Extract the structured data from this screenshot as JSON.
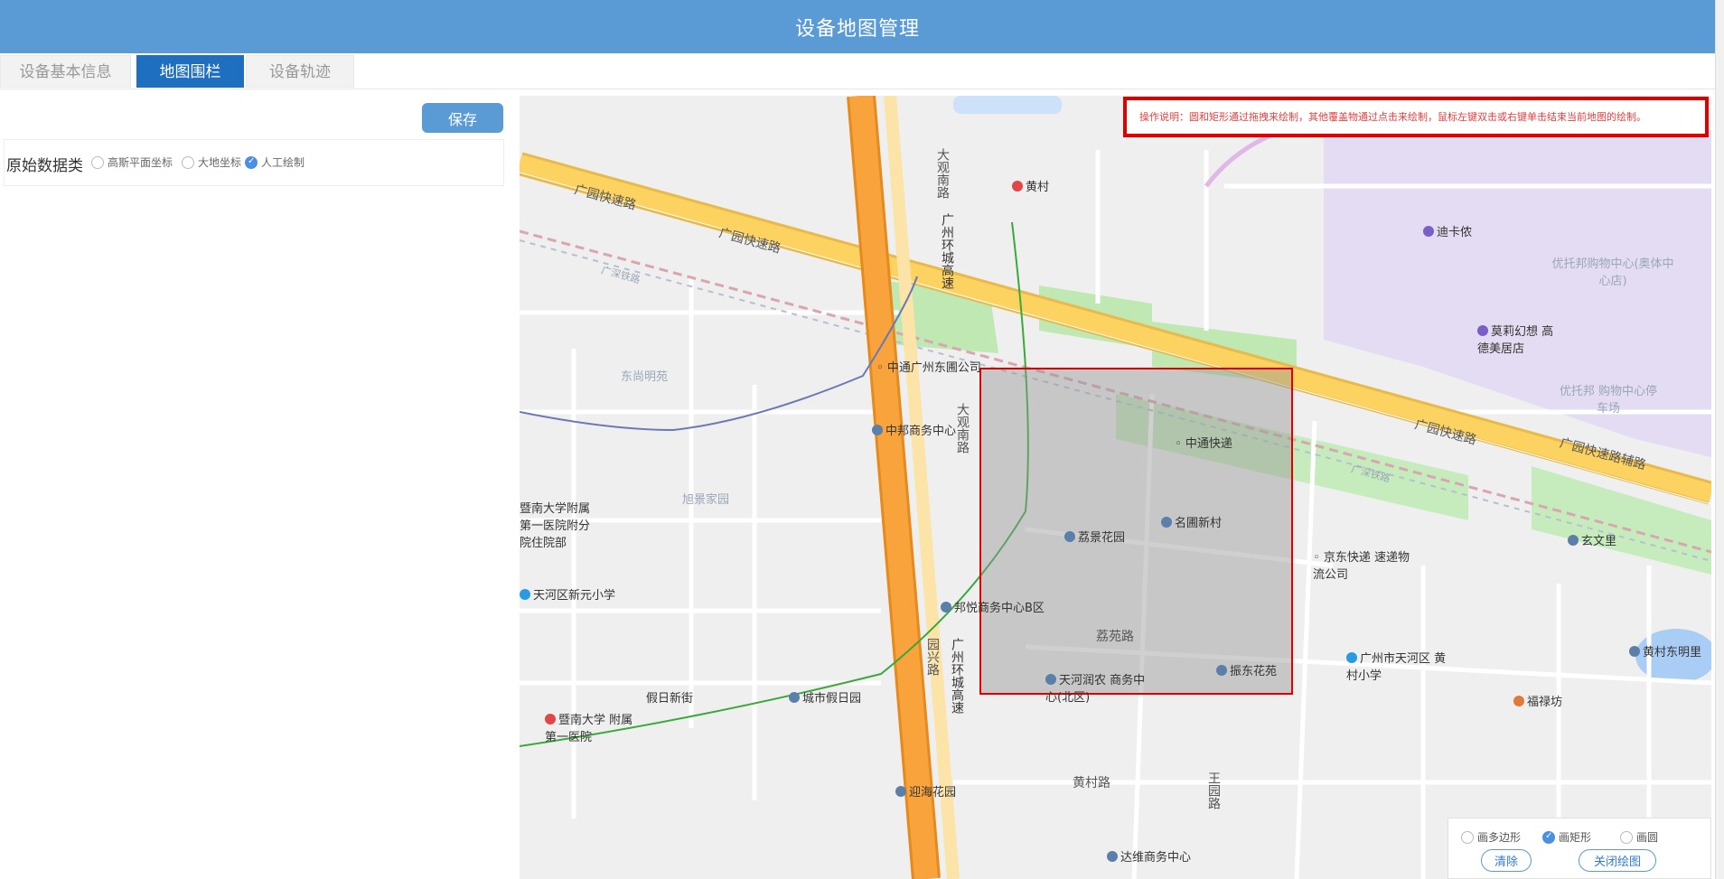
{
  "header": {
    "title": "设备地图管理"
  },
  "tabs": [
    {
      "label": "设备基本信息",
      "active": false
    },
    {
      "label": "地图围栏",
      "active": true
    },
    {
      "label": "设备轨迹",
      "active": false
    }
  ],
  "left": {
    "save_label": "保存",
    "data_type_label": "原始数据类",
    "options": [
      {
        "label": "高斯平面坐标",
        "checked": false
      },
      {
        "label": "大地坐标",
        "checked": false
      },
      {
        "label": "人工绘制",
        "checked": true
      }
    ]
  },
  "map": {
    "instruction": "操作说明：圆和矩形通过拖拽来绘制，其他覆盖物通过点击来绘制，鼠标左键双击或右键单击结束当前地图的绘制。",
    "labels": {
      "road1": "广园快速路",
      "road2": "广园快速路",
      "road3": "广园快速路",
      "road4": "广园快速路辅路",
      "ring": "广州环城高速",
      "ring2": "广州环城高速",
      "daguan": "大观南路",
      "daguan2": "大观南路",
      "huangcun": "黄村",
      "dikanong": "迪卡侬",
      "youtuo": "优托邦购物中心(奥体中心店)",
      "moli": "莫莉幻想 高德美居店",
      "youtuo2": "优托邦 购物中心停车场",
      "zhongtong": "中通广州东圃公司",
      "dongshang": "东尚明苑",
      "zhongbang": "中邦商务中心",
      "zhongtongkd": "中通快递",
      "lijing": "荔景花园",
      "mingyuan": "名圃新村",
      "xujing": "旭景家园",
      "jinanhosp": "暨南大学附属第一医院附分院住院部",
      "tianhexy": "天河区新元小学",
      "bangyue": "邦悦商务中心B区",
      "jingdong": "京东快递 速递物流公司",
      "xuanwen": "玄文里",
      "liyuan": "荔苑路",
      "yuanxing": "园兴路",
      "tianrun": "天河润农 商务中心(北区)",
      "zhendong": "振东花苑",
      "guangzhoutianhe": "广州市天河区 黄村小学",
      "huangcundongming": "黄村东明里",
      "fulufang": "福禄坊",
      "jiarijie": "假日新街",
      "chengshi": "城市假日园",
      "jinan2": "暨南大学 附属第一医院",
      "yinghai": "迎海花园",
      "huangcunlu": "黄村路",
      "wangyuan": "王园路",
      "dawei": "达维商务中心",
      "guangshen": "广深铁路",
      "guangshen2": "广深铁路"
    }
  },
  "draw_panel": {
    "options": [
      {
        "label": "画多边形",
        "checked": false
      },
      {
        "label": "画矩形",
        "checked": true
      },
      {
        "label": "画圆",
        "checked": false
      }
    ],
    "clear_label": "清除",
    "close_label": "关闭绘图"
  },
  "colors": {
    "header": "#5b9bd5",
    "active_tab": "#1e6fbf",
    "highway": "#f5a623",
    "expressway": "#fcc93e",
    "fence_border": "#e00000",
    "instruction_border": "#e00000"
  }
}
